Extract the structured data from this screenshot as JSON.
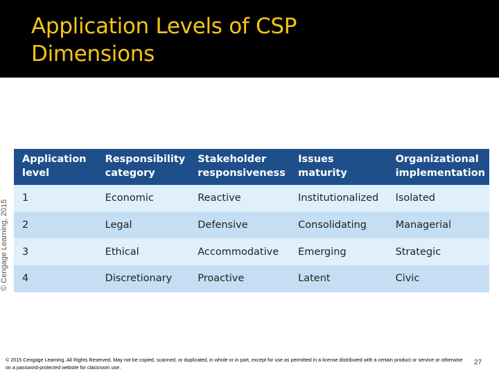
{
  "slide": {
    "title_line1": "Application Levels of CSP",
    "title_line2": "Dimensions",
    "title_color": "#f5c518",
    "header_band_color": "#000000"
  },
  "side_credit": "© Cengage Learning, 2015",
  "table": {
    "header_color": "#1e4f8a",
    "row_colors": [
      "#dfeffb",
      "#c6def3"
    ],
    "columns": [
      {
        "line1": "Application",
        "line2": "level"
      },
      {
        "line1": "Responsibility",
        "line2": "category"
      },
      {
        "line1": "Stakeholder",
        "line2": "responsiveness"
      },
      {
        "line1": "Issues",
        "line2": "maturity"
      },
      {
        "line1": "Organizational",
        "line2": "implementation"
      }
    ],
    "rows": [
      [
        "1",
        "Economic",
        "Reactive",
        "Institutionalized",
        "Isolated"
      ],
      [
        "2",
        "Legal",
        "Defensive",
        "Consolidating",
        "Managerial"
      ],
      [
        "3",
        "Ethical",
        "Accommodative",
        "Emerging",
        "Strategic"
      ],
      [
        "4",
        "Discretionary",
        "Proactive",
        "Latent",
        "Civic"
      ]
    ]
  },
  "footer": {
    "copyright": "© 2015 Cengage Learning. All Rights Reserved. May not be copied, scanned, or duplicated, in whole or in part, except for use as permitted in a license distributed with a certain product or service or otherwise on a password-protected website for classroom use.",
    "page_number": "27"
  }
}
